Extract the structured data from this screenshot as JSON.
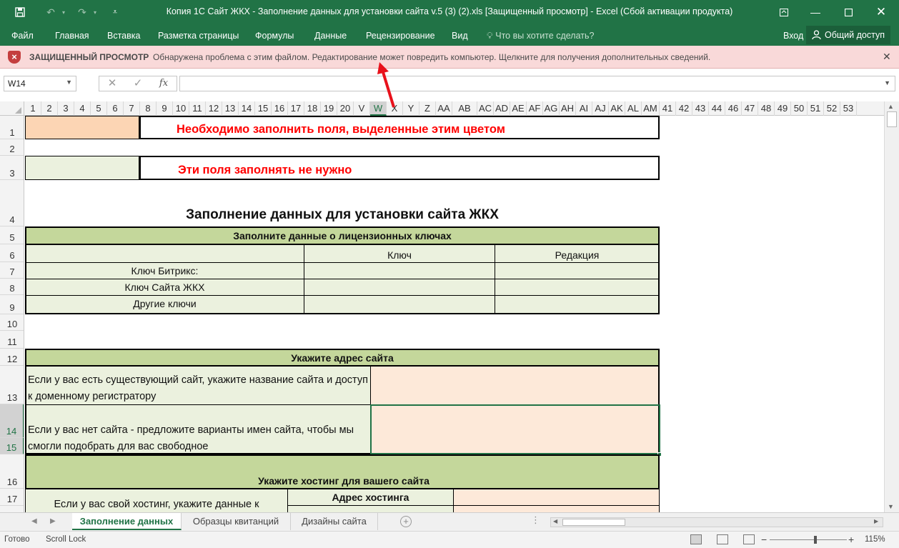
{
  "titlebar": {
    "title": "Копия 1С Сайт ЖКХ - Заполнение данных для установки сайта v.5 (3) (2).xls  [Защищенный просмотр] - Excel (Сбой активации продукта)",
    "save_icon": "save-icon",
    "undo_icon": "undo-icon",
    "redo_icon": "redo-icon"
  },
  "ribbon": {
    "tabs": [
      "Файл",
      "Главная",
      "Вставка",
      "Разметка страницы",
      "Формулы",
      "Данные",
      "Рецензирование",
      "Вид"
    ],
    "tell_me": "Что вы хотите сделать?",
    "signin": "Вход",
    "share": "Общий доступ"
  },
  "protected_view": {
    "title": "ЗАЩИЩЕННЫЙ ПРОСМОТР",
    "message": "Обнаружена проблема с этим файлом. Редактирование может повредить компьютер. Щелкните для получения дополнительных сведений.",
    "accent": "#c43e3e"
  },
  "formula_bar": {
    "name_box": "W14",
    "cancel": "✕",
    "enter": "✓",
    "fx": "fx",
    "value": ""
  },
  "columns": [
    "1",
    "2",
    "3",
    "4",
    "5",
    "6",
    "7",
    "8",
    "9",
    "10",
    "11",
    "12",
    "13",
    "14",
    "15",
    "16",
    "17",
    "18",
    "19",
    "20",
    "V",
    "W",
    "X",
    "Y",
    "Z",
    "AA",
    "AB",
    "AC",
    "AD",
    "AE",
    "AF",
    "AG",
    "AH",
    "AI",
    "AJ",
    "AK",
    "AL",
    "AM",
    "41",
    "42",
    "43",
    "44",
    "46",
    "47",
    "48",
    "49",
    "50",
    "51",
    "52",
    "53"
  ],
  "selected_column": "W",
  "rows": [
    "1",
    "2",
    "3",
    "4",
    "5",
    "6",
    "7",
    "8",
    "9",
    "10",
    "11",
    "12",
    "13",
    "14",
    "15",
    "16",
    "17"
  ],
  "selected_rows": [
    "14",
    "15"
  ],
  "sheet": {
    "legend_fill": "Необходимо заполнить поля, выделенные этим цветом",
    "legend_nofill": "Эти поля заполнять не нужно",
    "main_title": "Заполнение данных для установки сайта ЖКХ",
    "licenses": {
      "header": "Заполните данные о лицензионных ключах",
      "col_key": "Ключ",
      "col_edition": "Редакция",
      "rows": [
        "Ключ Битрикс:",
        "Ключ Сайта ЖКХ",
        "Другие ключи"
      ]
    },
    "address": {
      "header": "Укажите адрес сайта",
      "have_site": "Если у вас есть существующий сайт, укажите название сайта и доступ к доменному регистратору",
      "no_site": "Если у вас нет сайта - предложите варианты имен сайта, чтобы мы смогли подобрать для вас свободное"
    },
    "hosting": {
      "header": "Укажите хостинг для вашего сайта",
      "own_hosting": "Если у вас свой хостинг, укажите данные к",
      "address_label": "Адрес хостинга"
    }
  },
  "sheet_tabs": [
    "Заполнение данных",
    "Образцы квитанций",
    "Дизайны сайта"
  ],
  "active_sheet": "Заполнение данных",
  "status": {
    "ready": "Готово",
    "scroll_lock": "Scroll Lock",
    "zoom": "115%"
  },
  "colors": {
    "excel_green": "#217346",
    "fill_required": "#fcd5b4",
    "fill_input": "#fde9d9",
    "fill_optional": "#ebf1de",
    "header_green": "#c4d79b",
    "annotation_red": "#e8111b"
  }
}
